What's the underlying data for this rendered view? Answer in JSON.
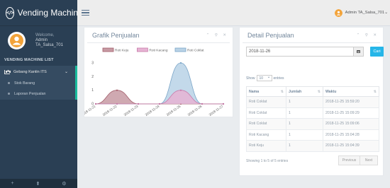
{
  "app": {
    "title": "Vending Machine",
    "logo_glyph": "</>"
  },
  "profile": {
    "welcome": "Welcome,",
    "name_line1": "Admin",
    "name_line2": "TA_Salsa_701"
  },
  "sidebar": {
    "section_title": "VENDING MACHINE LIST",
    "menu": {
      "label": "Gebang Kantin ITS",
      "chevron": "⌄"
    },
    "subitems": [
      {
        "label": "Stok Barang"
      },
      {
        "label": "Laporan Penjualan"
      }
    ],
    "footer_icons": [
      "+",
      "⬆",
      "⚙"
    ]
  },
  "topnav": {
    "user": "Admin TA_Salsa_701",
    "caret": "⌄"
  },
  "grafik": {
    "title": "Grafik Penjualan",
    "tools": "⌃ ⚲ ✕"
  },
  "chart_data": {
    "type": "area",
    "title": "",
    "categories": [
      "2018-11-21",
      "2018-11-22",
      "2018-11-23",
      "2018-11-24",
      "2018-11-25",
      "2018-11-26",
      "2018-11-27"
    ],
    "ylim": [
      0,
      3
    ],
    "yticks": [
      "0",
      "1",
      "2",
      "3"
    ],
    "legend_position": "top",
    "series": [
      {
        "name": "Roti Keju",
        "values": [
          0,
          1,
          0,
          0,
          0,
          0,
          0
        ],
        "color": "#c79aa3",
        "stroke": "#a35e6b"
      },
      {
        "name": "Roti Kacang",
        "values": [
          0,
          0,
          0,
          0,
          1,
          0,
          0
        ],
        "color": "#e6b3d3",
        "stroke": "#c97cab"
      },
      {
        "name": "Roti Coklat",
        "values": [
          0,
          0,
          0,
          0,
          3,
          0,
          0
        ],
        "color": "#b9d2e6",
        "stroke": "#7ca6c8"
      }
    ]
  },
  "detail": {
    "title": "Detail Penjualan",
    "tools": "⌃ ⚲ ✕",
    "date_value": "2018-11-26",
    "search_label": "Cari",
    "show_label": "Show",
    "entries_value": "10",
    "entries_label": "entries",
    "columns": [
      "Nama",
      "Jumlah",
      "Waktu"
    ],
    "sort_glyph": "⇅",
    "rows": [
      {
        "nama": "Roti Coklat",
        "jumlah": "1",
        "waktu": "2018-11-25 15:59:20"
      },
      {
        "nama": "Roti Coklat",
        "jumlah": "1",
        "waktu": "2018-11-25 15:09:29"
      },
      {
        "nama": "Roti Coklat",
        "jumlah": "1",
        "waktu": "2018-11-25 15:09:06"
      },
      {
        "nama": "Roti Kacang",
        "jumlah": "1",
        "waktu": "2018-11-25 15:04:28"
      },
      {
        "nama": "Roti Keju",
        "jumlah": "1",
        "waktu": "2018-11-25 15:04:39"
      }
    ],
    "info": "Showing 1 to 5 of 5 entries",
    "prev_label": "Previous",
    "next_label": "Next"
  }
}
